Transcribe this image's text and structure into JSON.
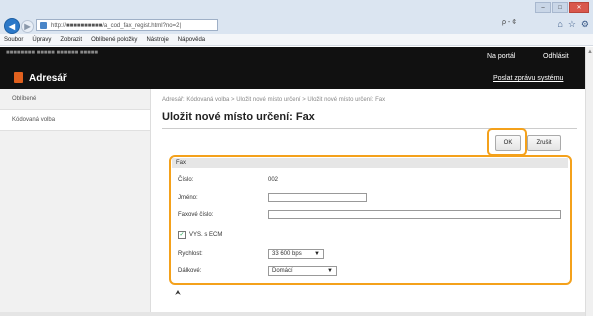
{
  "browser": {
    "url": "http://■■■■■■■■■■/a_cod_fax_regist.html?no=2|",
    "tools": "ρ - ¢",
    "window_buttons": [
      "–",
      "□",
      "✕"
    ],
    "right_icons": [
      "⌂",
      "☆",
      "⚙"
    ],
    "menu": [
      "Soubor",
      "Úpravy",
      "Zobrazit",
      "Oblíbené položky",
      "Nástroje",
      "Nápověda"
    ]
  },
  "header": {
    "host": "■■■■■■■■  ■■■■■  ■■■■■■  ■■■■■",
    "title": "Adresář",
    "portal_link": "Na portál",
    "logout_link": "Odhlásit",
    "report_link": "Poslat zprávu systému"
  },
  "sidebar": {
    "items": [
      {
        "label": "Oblíbené"
      },
      {
        "label": "Kódovaná volba"
      }
    ]
  },
  "main": {
    "breadcrumb": "Adresář: Kódovaná volba > Uložit nové místo určení > Uložit nové místo určení: Fax",
    "title": "Uložit nové místo určení: Fax",
    "ok_label": "OK",
    "cancel_label": "Zrušit",
    "section_label": "Fax",
    "number_label": "Číslo:",
    "number_value": "002",
    "name_label": "Jméno:",
    "name_value": "",
    "fax_label": "Faxové číslo:",
    "fax_value": "",
    "ecm_label": "VYS. s ECM",
    "ecm_checked": true,
    "speed_label": "Rychlost:",
    "speed_value": "33 600 bps",
    "distance_label": "Dálkové:",
    "distance_value": "Domácí",
    "to_top_symbol": "⮝"
  },
  "colors": {
    "highlight": "#f4a11b",
    "header_bg": "#111111",
    "logo": "#e0601e"
  }
}
